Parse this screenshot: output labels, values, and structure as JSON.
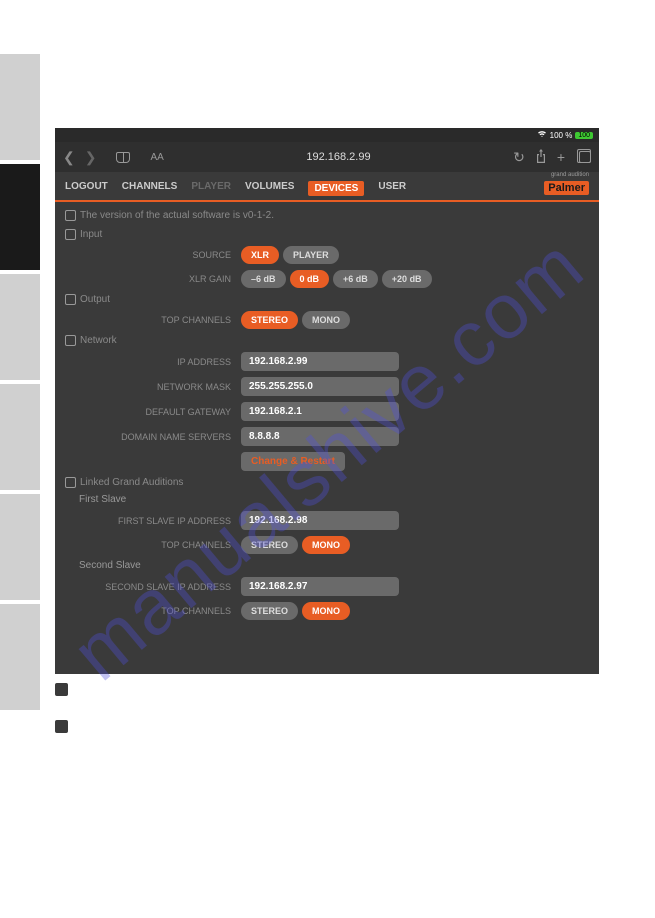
{
  "side_tabs": {
    "count": 6,
    "active_index": 1
  },
  "status": {
    "wifi": "wifi",
    "battery_pct": "100 %",
    "battery_badge": "100"
  },
  "browser": {
    "url": "192.168.2.99",
    "aa": "AA"
  },
  "app": {
    "nav": {
      "logout": "LOGOUT",
      "channels": "CHANNELS",
      "player": "PLAYER",
      "volumes": "VOLUMES",
      "devices": "DEVICES",
      "user": "USER"
    },
    "logo": {
      "sub": "grand audition",
      "main": "Palmer"
    }
  },
  "content": {
    "version_text": "The version of the actual software is v0-1-2.",
    "sections": {
      "input": "Input",
      "output": "Output",
      "network": "Network",
      "linked": "Linked Grand Auditions",
      "first_slave": "First Slave",
      "second_slave": "Second Slave"
    },
    "labels": {
      "source": "SOURCE",
      "xlr_gain": "XLR GAIN",
      "top_channels": "TOP CHANNELS",
      "ip_address": "IP ADDRESS",
      "network_mask": "NETWORK MASK",
      "default_gateway": "DEFAULT GATEWAY",
      "domain_name_servers": "DOMAIN NAME SERVERS",
      "first_slave_ip": "FIRST SLAVE IP ADDRESS",
      "second_slave_ip": "SECOND SLAVE IP ADDRESS"
    },
    "options": {
      "source": {
        "xlr": "XLR",
        "player": "PLAYER"
      },
      "gain": {
        "m6": "–6 dB",
        "z": "0 dB",
        "p6": "+6 dB",
        "p20": "+20 dB"
      },
      "channels": {
        "stereo": "STEREO",
        "mono": "MONO"
      }
    },
    "values": {
      "ip_address": "192.168.2.99",
      "network_mask": "255.255.255.0",
      "default_gateway": "192.168.2.1",
      "dns": "8.8.8.8",
      "change_restart": "Change & Restart",
      "first_slave_ip": "192.168.2.98",
      "second_slave_ip": "192.168.2.97"
    }
  },
  "watermark": "manualshive.com"
}
